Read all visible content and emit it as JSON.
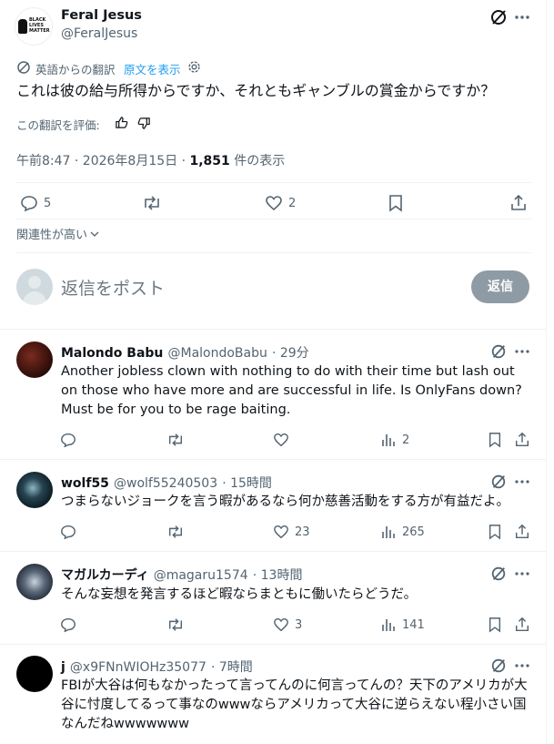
{
  "tweet": {
    "author_name": "Feral Jesus",
    "author_handle": "@FeralJesus",
    "avatar_logo_text": "BLACK LIVES MATTER",
    "translation_label": "英語からの翻訳",
    "show_original": "原文を表示",
    "text": "これは彼の給与所得からですか、それともギャンブルの賞金からですか？",
    "rate_translation": "この翻訳を評価:",
    "timestamp": "午前8:47 · 2026年8月15日 · ",
    "views_count": "1,851",
    "views_label": " 件の表示",
    "actions": {
      "replies": "5",
      "retweets": "",
      "likes": "2"
    },
    "relevance_sort": "関連性が高い"
  },
  "composer": {
    "placeholder": "返信をポスト",
    "reply_button": "返信"
  },
  "replies": [
    {
      "name": "Malondo Babu",
      "handle": "@MalondoBabu",
      "time": "· 29分",
      "text": "Another jobless clown with nothing to do with their time but lash out on those who have more and are successful in life.  Is OnlyFans down?  Must be for you to be rage baiting.",
      "likes": "",
      "views": "2"
    },
    {
      "name": "wolf55",
      "handle": "@wolf55240503",
      "time": "· 15時間",
      "text": "つまらないジョークを言う暇があるなら何か慈善活動をする方が有益だよ。",
      "likes": "23",
      "views": "265"
    },
    {
      "name": "マガルカーディ",
      "handle": "@magaru1574",
      "time": "· 13時間",
      "text": "そんな妄想を発言するほど暇ならまともに働いたらどうだ。",
      "likes": "3",
      "views": "141"
    },
    {
      "name": "j",
      "handle": "@x9FNnWIOHz35077",
      "time": "· 7時間",
      "text": "FBIが大谷は何もなかったって言ってんのに何言ってんの？天下のアメリカが大谷に忖度してるって事なのwwwならアメリカって大谷に逆らえない程小さい国なんだねwwwwwww",
      "likes": "",
      "views": ""
    }
  ],
  "colors": {
    "accent": "#1d9bf0",
    "muted": "#536471",
    "border": "#eff3f4",
    "reply_btn_bg": "#8e9ba4"
  }
}
